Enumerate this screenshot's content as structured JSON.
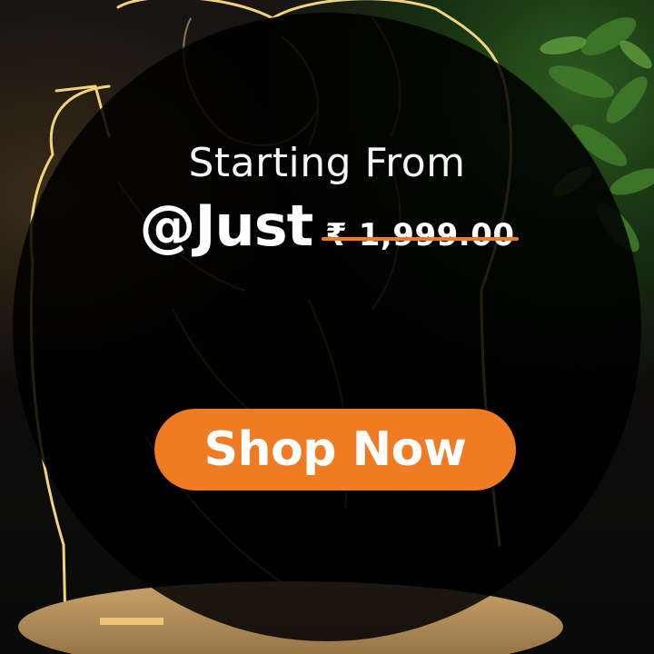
{
  "promo": {
    "headline": "Starting From",
    "price_prefix": "@Just",
    "original_price": "₹ 1,999.00",
    "cta_label": "Shop Now"
  },
  "colors": {
    "accent": "#ef7b22",
    "text": "#ffffff",
    "overlay": "#000000"
  }
}
